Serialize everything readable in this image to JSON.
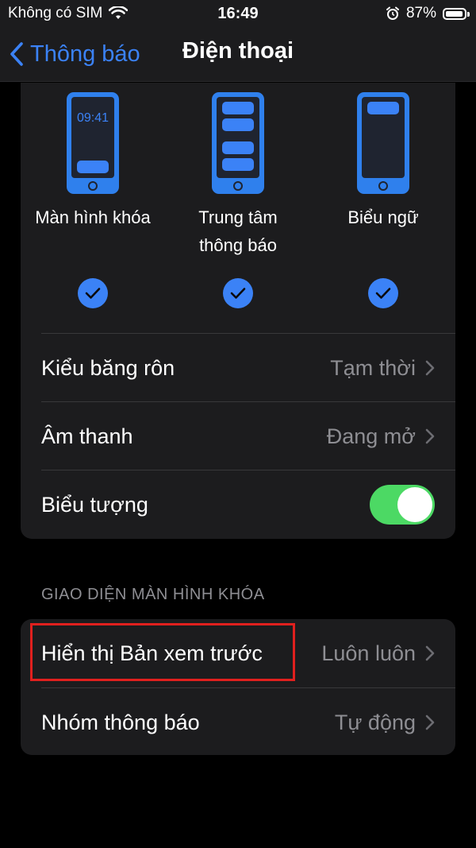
{
  "status": {
    "carrier": "Không có SIM",
    "time": "16:49",
    "battery": "87%"
  },
  "nav": {
    "back_label": "Thông báo",
    "title": "Điện thoại"
  },
  "previews": [
    {
      "label": "Màn hình khóa",
      "clock": "09:41"
    },
    {
      "label1": "Trung tâm",
      "label2": "thông báo"
    },
    {
      "label": "Biểu ngữ"
    }
  ],
  "settings": {
    "banner_style": {
      "label": "Kiểu băng rôn",
      "value": "Tạm thời"
    },
    "sounds": {
      "label": "Âm thanh",
      "value": "Đang mở"
    },
    "badges": {
      "label": "Biểu tượng",
      "enabled": true
    }
  },
  "lock_screen": {
    "header": "GIAO DIỆN MÀN HÌNH KHÓA",
    "show_previews": {
      "label": "Hiển thị Bản xem trước",
      "value": "Luôn luôn"
    },
    "grouping": {
      "label": "Nhóm thông báo",
      "value": "Tự động"
    }
  },
  "colors": {
    "accent": "#3b82f6",
    "toggle_on": "#4cd964",
    "highlight": "#e0201e"
  }
}
